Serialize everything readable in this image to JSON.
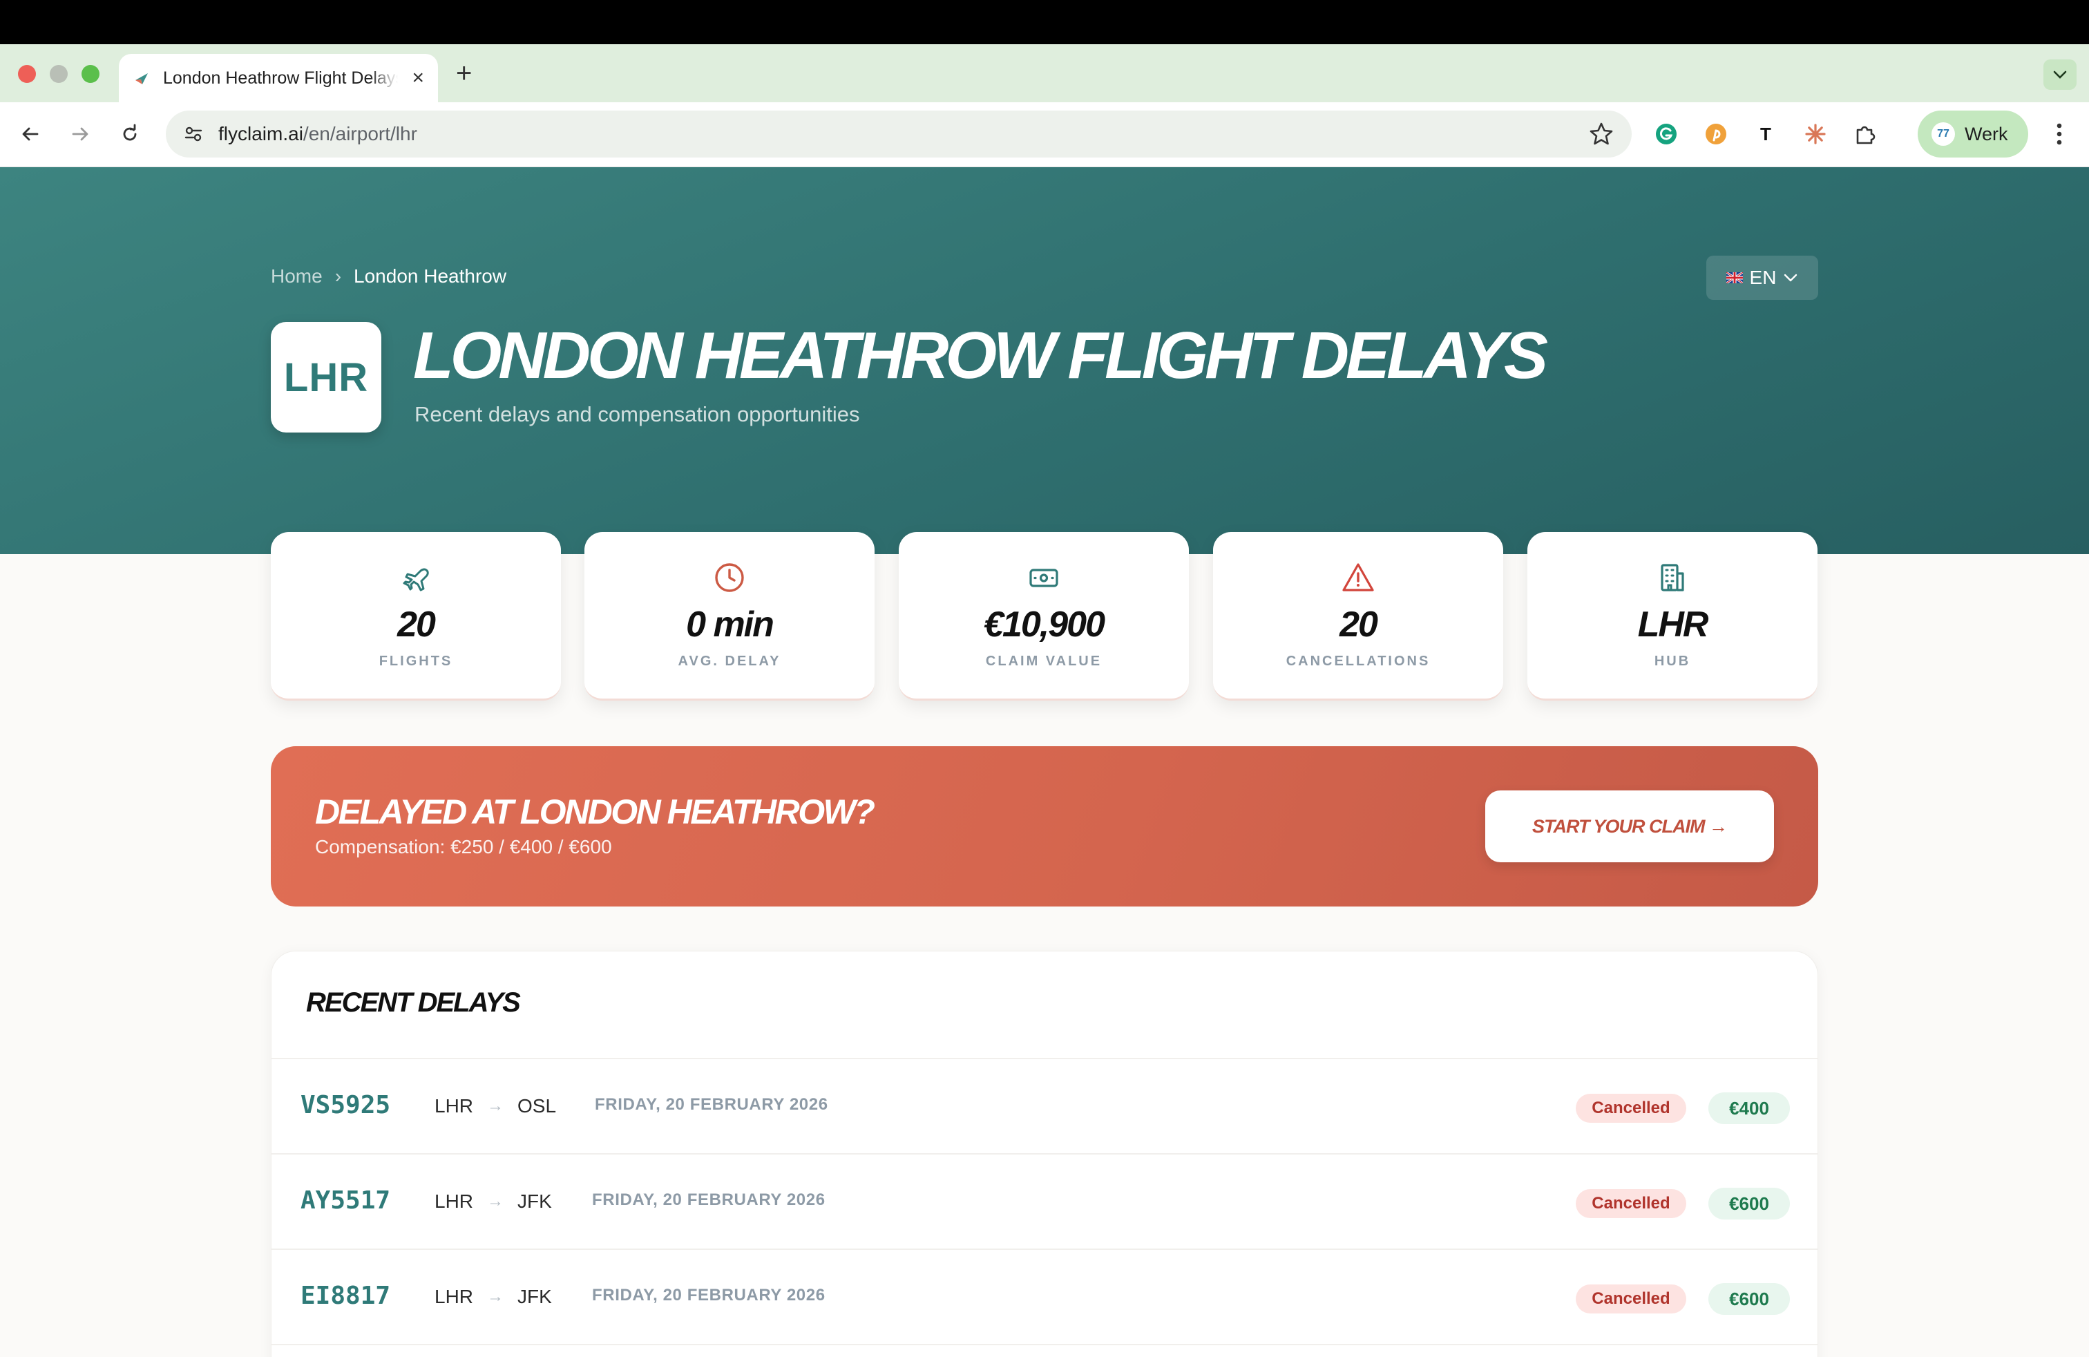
{
  "browser": {
    "tab_title": "London Heathrow Flight Delays",
    "tab_close": "×",
    "new_tab": "+",
    "url_host": "flyclaim.ai",
    "url_path": "/en/airport/lhr",
    "profile_badge": "77",
    "profile_name": "Werk",
    "extension_t": "T"
  },
  "breadcrumb": {
    "home": "Home",
    "separator": "›",
    "current": "London Heathrow"
  },
  "language": {
    "code": "EN"
  },
  "hero": {
    "badge": "LHR",
    "title": "LONDON HEATHROW FLIGHT DELAYS",
    "subtitle": "Recent delays and compensation opportunities"
  },
  "stats": [
    {
      "value": "20",
      "label": "FLIGHTS",
      "icon": "plane-icon",
      "color": "#2f7a78"
    },
    {
      "value": "0 min",
      "label": "AVG. DELAY",
      "icon": "clock-icon",
      "color": "#cc5a44"
    },
    {
      "value": "€10,900",
      "label": "CLAIM VALUE",
      "icon": "banknote-icon",
      "color": "#2f7a78"
    },
    {
      "value": "20",
      "label": "CANCELLATIONS",
      "icon": "warning-icon",
      "color": "#d2453b"
    },
    {
      "value": "LHR",
      "label": "HUB",
      "icon": "building-icon",
      "color": "#2f7a78"
    }
  ],
  "cta": {
    "title": "DELAYED AT LONDON HEATHROW?",
    "subtitle": "Compensation: €250 / €400 / €600",
    "button": "START YOUR CLAIM →"
  },
  "recent_delays": {
    "title": "RECENT DELAYS",
    "rows": [
      {
        "flight": "VS5925",
        "from": "LHR",
        "to": "OSL",
        "date": "FRIDAY, 20 FEBRUARY 2026",
        "status": "Cancelled",
        "amount": "€400"
      },
      {
        "flight": "AY5517",
        "from": "LHR",
        "to": "JFK",
        "date": "FRIDAY, 20 FEBRUARY 2026",
        "status": "Cancelled",
        "amount": "€600"
      },
      {
        "flight": "EI8817",
        "from": "LHR",
        "to": "JFK",
        "date": "FRIDAY, 20 FEBRUARY 2026",
        "status": "Cancelled",
        "amount": "€600"
      }
    ]
  },
  "colors": {
    "brand_teal": "#2f7a78",
    "accent_coral": "#d4654e",
    "status_cancelled": "#b0342c",
    "amount_green": "#1e7a4e"
  }
}
